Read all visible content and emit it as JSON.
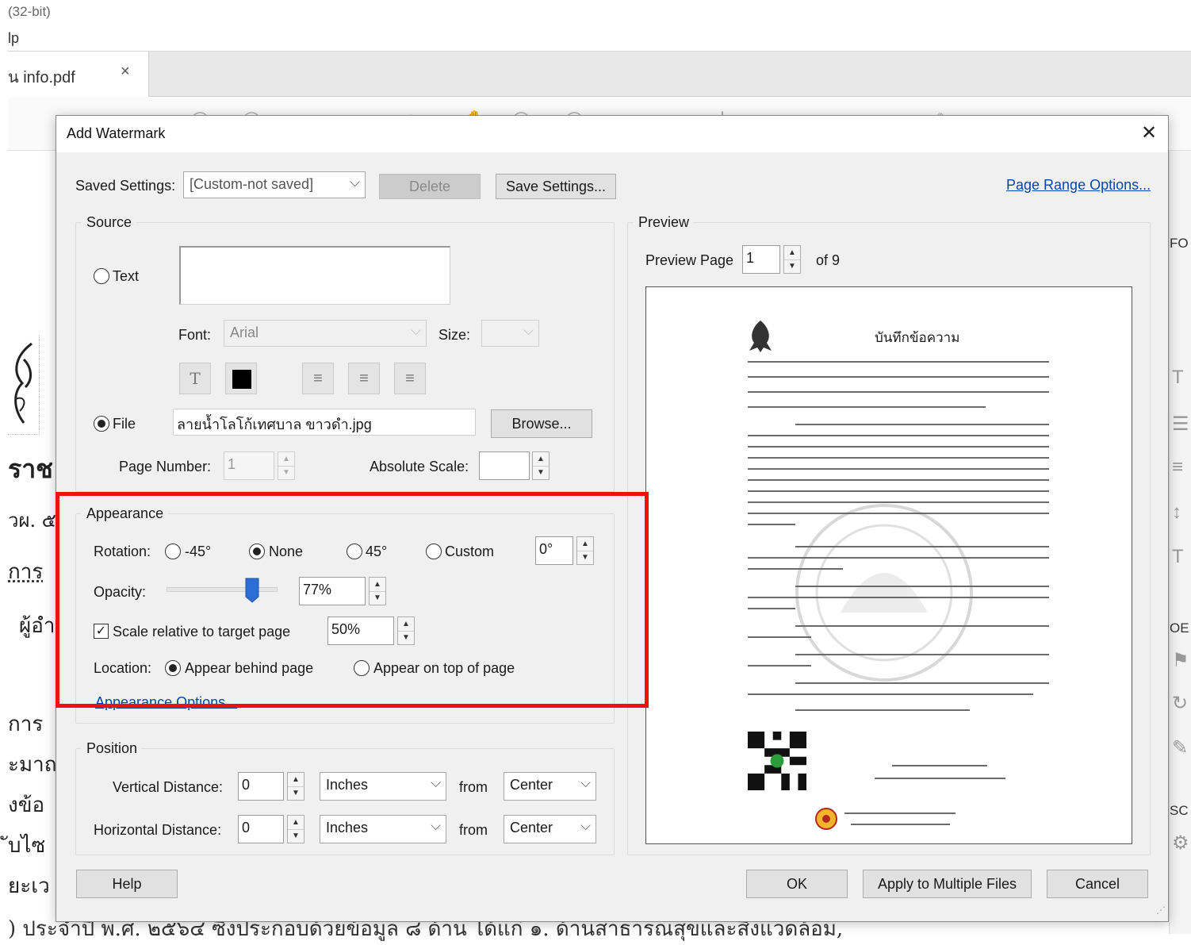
{
  "app": {
    "title_fragment": "(32-bit)",
    "menu_fragment": "lp",
    "tab": {
      "name": "น info.pdf",
      "close": "×"
    }
  },
  "document_text": {
    "heading_fragment": "ราช",
    "line2": "วผ. ๕",
    "line3": "การ",
    "line4": "ผู้อำ",
    "line5": "การ",
    "line6": "ะมาถ",
    "line7": "งข้อ",
    "line8": "ับไซ",
    "line9": "ยะเว",
    "bottom_line": ") ประจำปี พ.ศ. ๒๕๖๔ ซึ่งประกอบด้วยข้อมูล ๘ ด้าน ได้แก่ ๑. ด้านสาธารณสุขและสิ่งแวดล้อม,"
  },
  "right_panel": {
    "text1": "FO",
    "text2": "OE",
    "text3": "SC"
  },
  "dialog": {
    "title": "Add Watermark",
    "close_glyph": "✕",
    "saved_settings": {
      "label": "Saved Settings:",
      "value": "[Custom-not saved]",
      "delete_label": "Delete",
      "save_label": "Save Settings..."
    },
    "page_range_link": "Page Range Options...",
    "source": {
      "title": "Source",
      "text_option": "Text",
      "font_label": "Font:",
      "font_value": "Arial",
      "size_label": "Size:",
      "file_option": "File",
      "file_value": "ลายน้ำโลโก้เทศบาล ขาวดำ.jpg",
      "browse_label": "Browse...",
      "page_number_label": "Page Number:",
      "page_number_value": "1",
      "absolute_scale_label": "Absolute Scale:",
      "absolute_scale_value": "",
      "selected": "file"
    },
    "appearance": {
      "title": "Appearance",
      "rotation_label": "Rotation:",
      "rotation_options": [
        "-45°",
        "None",
        "45°",
        "Custom"
      ],
      "rotation_selected": "None",
      "custom_value": "0°",
      "opacity_label": "Opacity:",
      "opacity_value": "77%",
      "opacity": 0.77,
      "scale_checkbox_label": "Scale relative to target page",
      "scale_checked": true,
      "scale_value": "50%",
      "location_label": "Location:",
      "location_options": [
        "Appear behind page",
        "Appear on top of page"
      ],
      "location_selected": "Appear behind page",
      "options_link": "Appearance Options..."
    },
    "position": {
      "title": "Position",
      "vertical_label": "Vertical Distance:",
      "vertical_value": "0",
      "vertical_unit": "Inches",
      "vertical_from_label": "from",
      "vertical_from": "Center",
      "horizontal_label": "Horizontal Distance:",
      "horizontal_value": "0",
      "horizontal_unit": "Inches",
      "horizontal_from_label": "from",
      "horizontal_from": "Center"
    },
    "preview": {
      "title": "Preview",
      "page_label": "Preview Page",
      "page_value": "1",
      "of_label": "of 9",
      "doc_heading": "บันทึกข้อความ"
    },
    "buttons": {
      "help": "Help",
      "ok": "OK",
      "apply_multiple": "Apply to Multiple Files",
      "cancel": "Cancel"
    },
    "highlight_color": "#ee1111"
  }
}
